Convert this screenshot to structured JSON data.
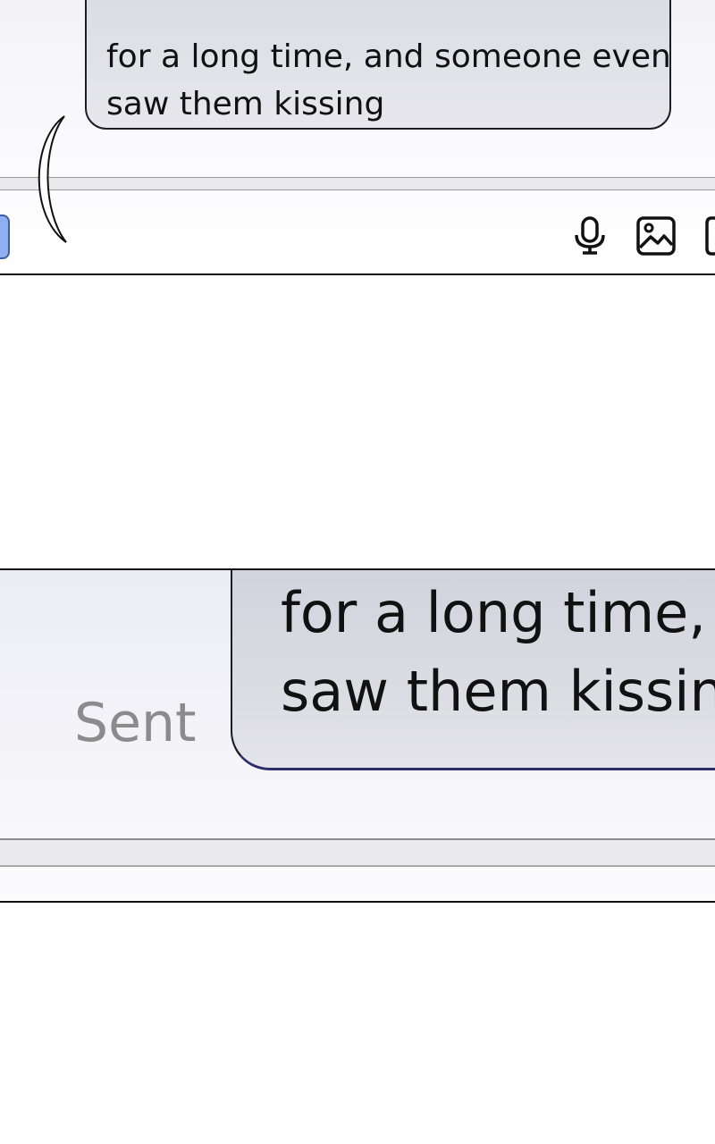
{
  "panel1": {
    "bubble_lines": [
      "for a long time, and someone even",
      "saw them kissing"
    ],
    "icons": [
      "microphone-icon",
      "image-icon",
      "camera-icon"
    ]
  },
  "panel2": {
    "status_text": "Sent",
    "bubble_lines": [
      "for a long time, and someone even",
      "saw them kissing"
    ]
  }
}
